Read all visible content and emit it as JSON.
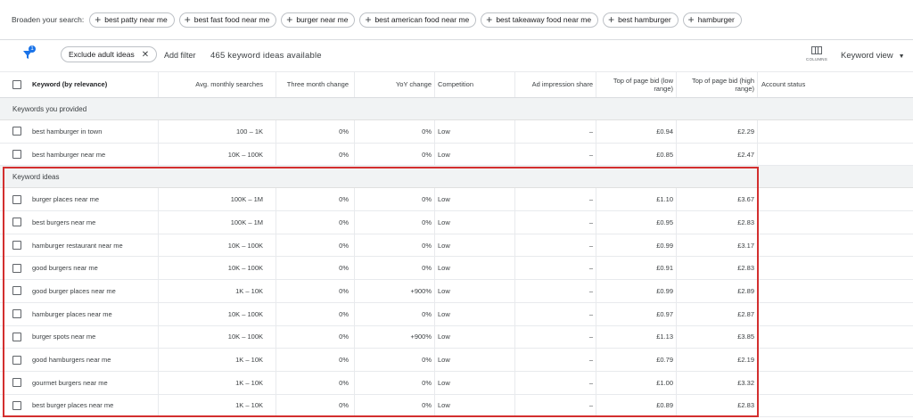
{
  "broaden": {
    "label": "Broaden your search:",
    "chips": [
      "best patty near me",
      "best fast food near me",
      "burger near me",
      "best american food near me",
      "best takeaway food near me",
      "best hamburger",
      "hamburger"
    ]
  },
  "toolbar": {
    "filter_badge": "1",
    "exclude_chip": "Exclude adult ideas",
    "add_filter": "Add filter",
    "ideas_count": "465 keyword ideas available",
    "columns_label": "COLUMNS",
    "view_label": "Keyword view"
  },
  "table": {
    "headers": [
      "Keyword (by relevance)",
      "Avg. monthly searches",
      "Three month change",
      "YoY change",
      "Competition",
      "Ad impression share",
      "Top of page bid (low range)",
      "Top of page bid (high range)",
      "Account status"
    ],
    "provided_title": "Keywords you provided",
    "provided_rows": [
      [
        "best hamburger in town",
        "100 – 1K",
        "0%",
        "0%",
        "Low",
        "–",
        "£0.94",
        "£2.29"
      ],
      [
        "best hamburger near me",
        "10K – 100K",
        "0%",
        "0%",
        "Low",
        "–",
        "£0.85",
        "£2.47"
      ]
    ],
    "ideas_title": "Keyword ideas",
    "idea_rows": [
      [
        "burger places near me",
        "100K – 1M",
        "0%",
        "0%",
        "Low",
        "–",
        "£1.10",
        "£3.67"
      ],
      [
        "best burgers near me",
        "100K – 1M",
        "0%",
        "0%",
        "Low",
        "–",
        "£0.95",
        "£2.83"
      ],
      [
        "hamburger restaurant near me",
        "10K – 100K",
        "0%",
        "0%",
        "Low",
        "–",
        "£0.99",
        "£3.17"
      ],
      [
        "good burgers near me",
        "10K – 100K",
        "0%",
        "0%",
        "Low",
        "–",
        "£0.91",
        "£2.83"
      ],
      [
        "good burger places near me",
        "1K – 10K",
        "0%",
        "+900%",
        "Low",
        "–",
        "£0.99",
        "£2.89"
      ],
      [
        "hamburger places near me",
        "10K – 100K",
        "0%",
        "0%",
        "Low",
        "–",
        "£0.97",
        "£2.87"
      ],
      [
        "burger spots near me",
        "10K – 100K",
        "0%",
        "+900%",
        "Low",
        "–",
        "£1.13",
        "£3.85"
      ],
      [
        "good hamburgers near me",
        "1K – 10K",
        "0%",
        "0%",
        "Low",
        "–",
        "£0.79",
        "£2.19"
      ],
      [
        "gourmet burgers near me",
        "1K – 10K",
        "0%",
        "0%",
        "Low",
        "–",
        "£1.00",
        "£3.32"
      ],
      [
        "best burger places near me",
        "1K – 10K",
        "0%",
        "0%",
        "Low",
        "–",
        "£0.89",
        "£2.83"
      ]
    ]
  },
  "colors": {
    "accent": "#1a73e8",
    "highlight": "#d32f2f",
    "section_bg": "#f1f3f4"
  }
}
